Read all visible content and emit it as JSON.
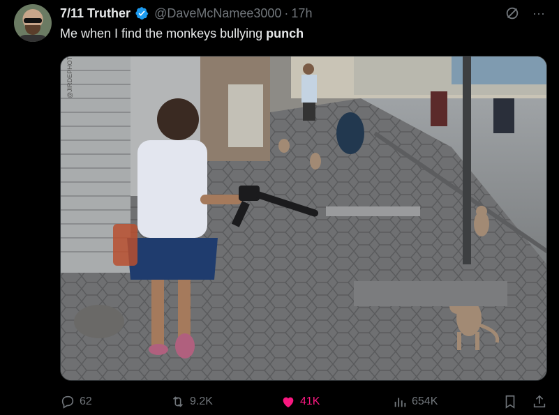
{
  "author": {
    "display_name": "7/11 Truther",
    "handle": "@DaveMcNamee3000",
    "separator": "·",
    "time": "17h",
    "verified": true,
    "avatar": "avatar-image"
  },
  "tweet": {
    "text_prefix": "Me when I find the monkeys bullying ",
    "text_bold": "punch"
  },
  "media": {
    "alt": "photo of a girl holding a toy gun facing monkeys on a sidewalk",
    "watermark": "@JIRDEPHOTO"
  },
  "top_actions": {
    "grok_icon": "grok-icon",
    "more_icon": "more-icon",
    "more_label": "···"
  },
  "metrics": {
    "replies": "62",
    "reposts": "9.2K",
    "likes": "41K",
    "views": "654K"
  },
  "colors": {
    "background": "#000000",
    "text": "#e7e9ea",
    "secondary": "#71767b",
    "like": "#f91880",
    "verified": "#1d9bf0"
  }
}
